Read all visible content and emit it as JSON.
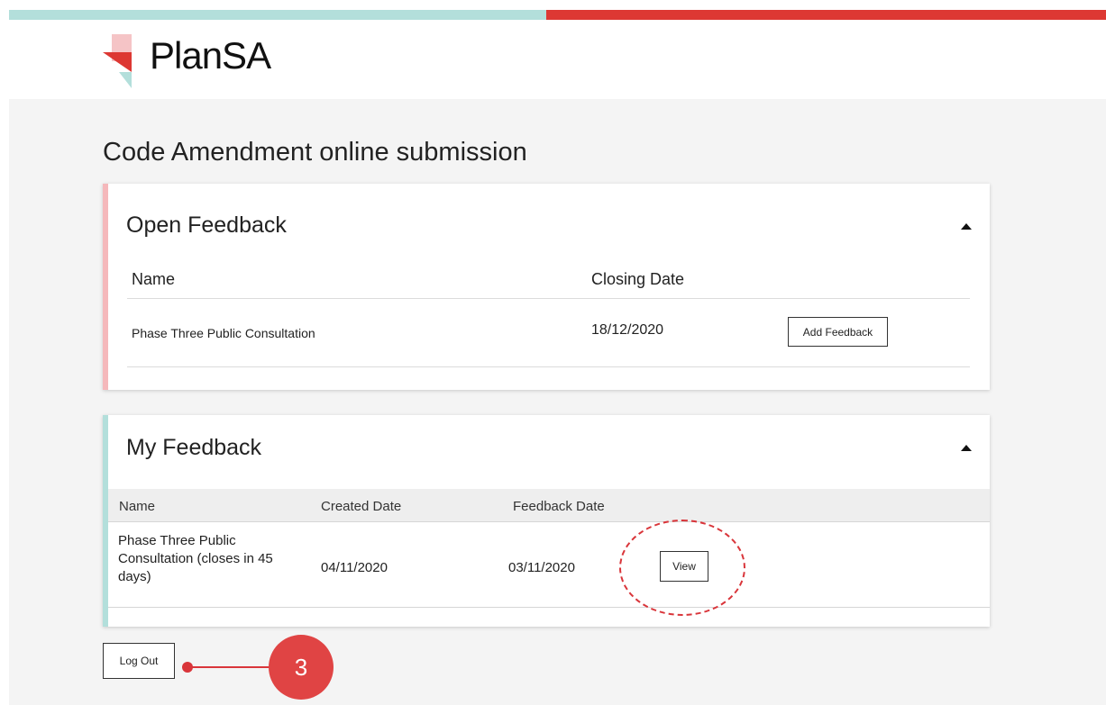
{
  "app": {
    "brand": "PlanSA"
  },
  "page": {
    "title": "Code Amendment online submission"
  },
  "open_feedback": {
    "title": "Open Feedback",
    "columns": {
      "name": "Name",
      "closing_date": "Closing Date"
    },
    "rows": [
      {
        "name": "Phase Three Public Consultation",
        "closing_date": "18/12/2020",
        "action": "Add Feedback"
      }
    ]
  },
  "my_feedback": {
    "title": "My Feedback",
    "columns": {
      "name": "Name",
      "created_date": "Created Date",
      "feedback_date": "Feedback Date"
    },
    "rows": [
      {
        "name_line1": "Phase Three Public",
        "name_line2": "Consultation (closes in 45",
        "name_line3": "days)",
        "created_date": "04/11/2020",
        "feedback_date": "03/11/2020",
        "action": "View"
      }
    ]
  },
  "footer": {
    "logout_label": "Log Out"
  },
  "annotation": {
    "step_number": "3",
    "color": "#d9353a"
  },
  "colors": {
    "teal": "#b3dfdb",
    "red": "#dd3833",
    "pink": "#f5b8bb"
  }
}
